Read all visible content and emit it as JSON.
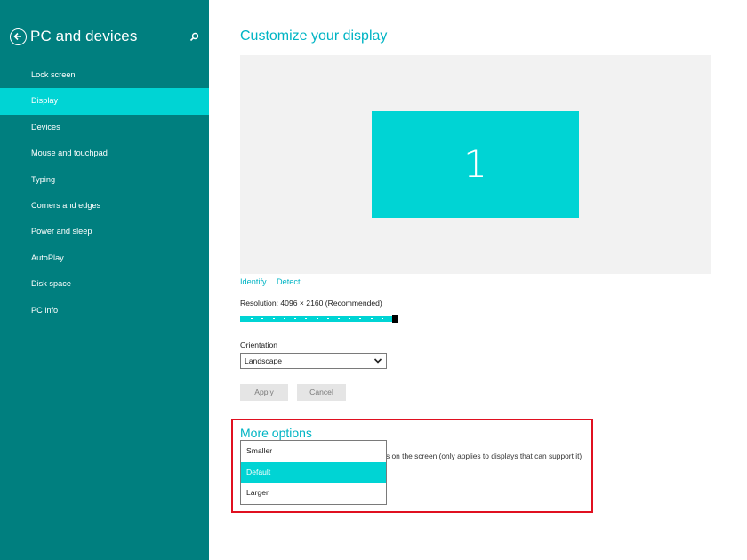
{
  "sidebar": {
    "title": "PC and devices",
    "items": [
      {
        "label": "Lock screen"
      },
      {
        "label": "Display",
        "selected": true
      },
      {
        "label": "Devices"
      },
      {
        "label": "Mouse and touchpad"
      },
      {
        "label": "Typing"
      },
      {
        "label": "Corners and edges"
      },
      {
        "label": "Power and sleep"
      },
      {
        "label": "AutoPlay"
      },
      {
        "label": "Disk space"
      },
      {
        "label": "PC info"
      }
    ],
    "icons": {
      "back": "back-arrow-icon",
      "search": "search-icon"
    }
  },
  "main": {
    "title": "Customize your display",
    "monitor_number": "1",
    "identify_label": "Identify",
    "detect_label": "Detect",
    "resolution_label": "Resolution: 4096 × 2160 (Recommended)",
    "resolution_level": 1.0,
    "resolution_steps": 14,
    "orientation_label": "Orientation",
    "orientation_value": "Landscape",
    "apply_label": "Apply",
    "cancel_label": "Cancel",
    "more_options_title": "More options",
    "size_description": "s on the screen (only applies to displays that can support it)",
    "size_options": [
      {
        "label": "Smaller"
      },
      {
        "label": "Default",
        "selected": true
      },
      {
        "label": "Larger"
      }
    ]
  },
  "colors": {
    "sidebar_bg": "#007f7f",
    "accent": "#00d4d4",
    "link": "#00b4c4",
    "highlight_border": "#e01020"
  }
}
